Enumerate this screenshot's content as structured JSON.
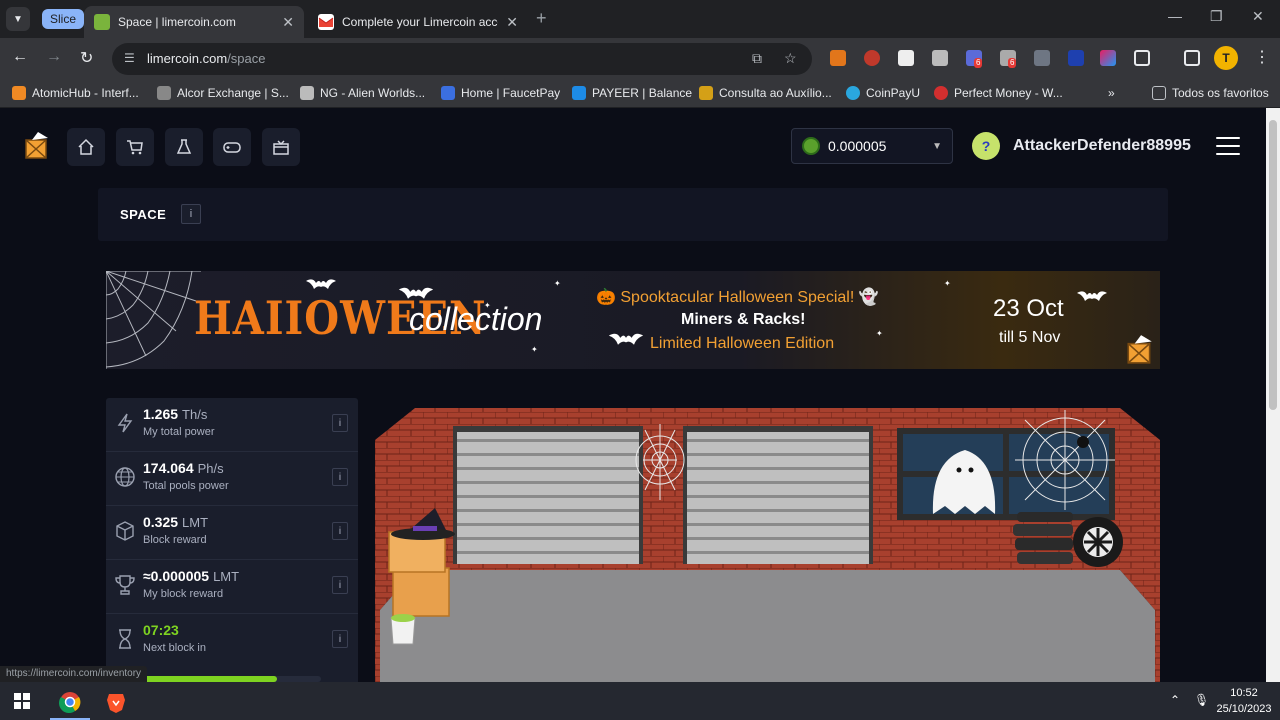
{
  "browser": {
    "tab_group_label": "Slice",
    "tabs": [
      {
        "title": "Space | limercoin.com",
        "active": true
      },
      {
        "title": "Complete your Limercoin acco",
        "active": false
      }
    ],
    "url_domain": "limercoin.com",
    "url_path": "/space",
    "extension_badges": [
      "6",
      "6"
    ],
    "bookmarks": [
      "AtomicHub - Interf...",
      "Alcor Exchange | S...",
      "NG - Alien Worlds...",
      "Home | FaucetPay",
      "PAYEER | Balance",
      "Consulta ao Auxílio...",
      "CoinPayU",
      "Perfect Money - W...",
      "Todos os favoritos"
    ],
    "status_hint": "https://limercoin.com/inventory"
  },
  "site": {
    "balance": "0.000005",
    "username": "AttackerDefender88995",
    "user_avatar_glyph": "?",
    "page_title": "SPACE",
    "info_glyph": "i",
    "nav_icons": [
      "home-icon",
      "cart-icon",
      "flask-icon",
      "gamepad-icon",
      "gift-box-icon"
    ]
  },
  "banner": {
    "title": "HAIIOWEEN",
    "subtitle": "collection",
    "line1": "🎃 Spooktacular Halloween Special! 👻",
    "line2": "Miners & Racks!",
    "line3": "Limited Halloween Edition",
    "date": "23 Oct",
    "till": "till 5 Nov"
  },
  "stats": [
    {
      "value": "1.265",
      "unit": "Th/s",
      "label": "My total power",
      "icon": "lightning-icon"
    },
    {
      "value": "174.064",
      "unit": "Ph/s",
      "label": "Total pools power",
      "icon": "globe-icon"
    },
    {
      "value": "0.325",
      "unit": "LMT",
      "label": "Block reward",
      "icon": "cube-icon"
    },
    {
      "value": "≈0.000005",
      "unit": "LMT",
      "label": "My block reward",
      "icon": "trophy-icon"
    },
    {
      "value": "07:23",
      "unit": "",
      "label": "Next block in",
      "icon": "hourglass-icon"
    }
  ],
  "next_block_progress": 0.75,
  "taskbar": {
    "time": "10:52",
    "date": "25/10/2023"
  },
  "colors": {
    "accent_green": "#7ed321",
    "orange": "#f07a1a",
    "page_bg": "#0b0d17",
    "panel_bg": "#1a1e2c"
  }
}
